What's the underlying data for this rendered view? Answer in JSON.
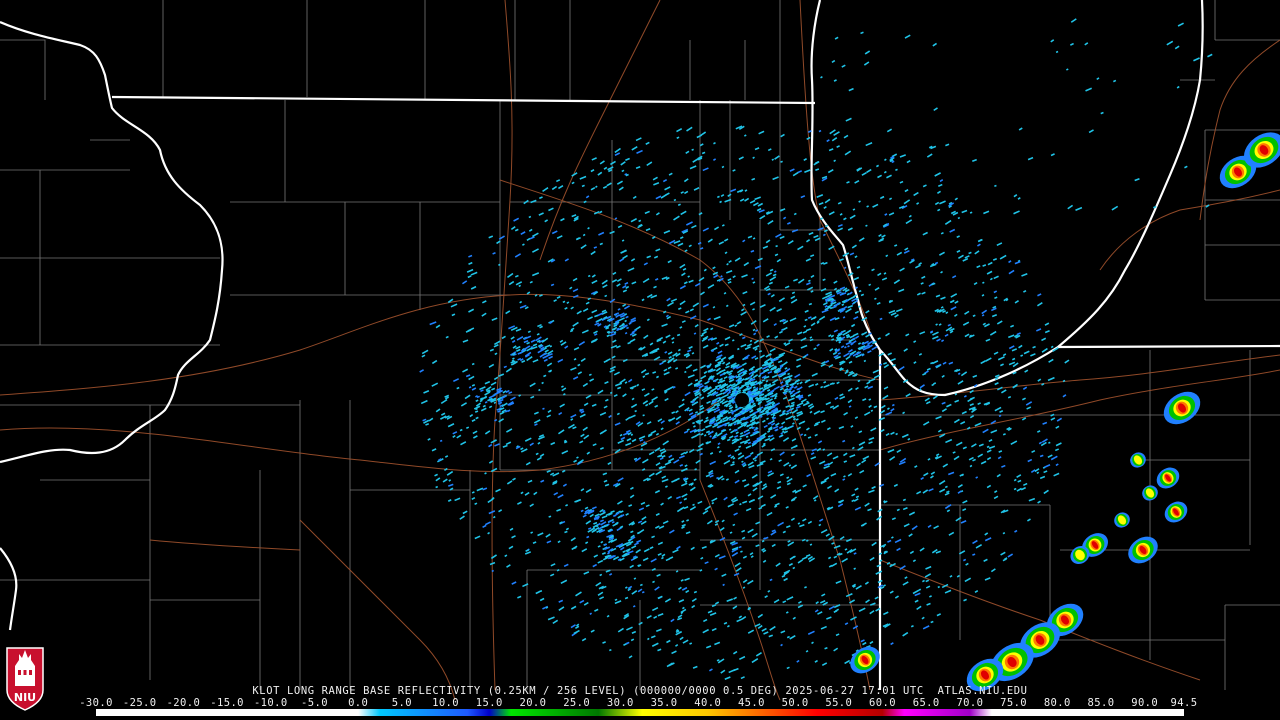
{
  "product": {
    "caption": "KLOT LONG RANGE BASE REFLECTIVITY (0.25KM / 256 LEVEL) (000000/0000 0.5 DEG) 2025-06-27 17:01 UTC  ATLAS.NIU.EDU"
  },
  "logo": {
    "text": "NIU"
  },
  "scale": {
    "ticks": [
      "-30.0",
      "-25.0",
      "-20.0",
      "-15.0",
      "-10.0",
      "-5.0",
      "0.0",
      "5.0",
      "10.0",
      "15.0",
      "20.0",
      "25.0",
      "30.0",
      "35.0",
      "40.0",
      "45.0",
      "50.0",
      "55.0",
      "60.0",
      "65.0",
      "70.0",
      "75.0",
      "80.0",
      "85.0",
      "90.0",
      "94.5"
    ],
    "stops": [
      {
        "dbz": -30,
        "color": "#ffffff"
      },
      {
        "dbz": 0,
        "color": "#ffffff"
      },
      {
        "dbz": 2.5,
        "color": "#00c8ff"
      },
      {
        "dbz": 12.5,
        "color": "#1e5aff"
      },
      {
        "dbz": 15,
        "color": "#0000c8"
      },
      {
        "dbz": 17.5,
        "color": "#00e600"
      },
      {
        "dbz": 27.5,
        "color": "#007800"
      },
      {
        "dbz": 32.5,
        "color": "#ffff00"
      },
      {
        "dbz": 40,
        "color": "#ffc800"
      },
      {
        "dbz": 45,
        "color": "#ff7800"
      },
      {
        "dbz": 52.5,
        "color": "#ff0000"
      },
      {
        "dbz": 60,
        "color": "#b40000"
      },
      {
        "dbz": 62.5,
        "color": "#ff00ff"
      },
      {
        "dbz": 70,
        "color": "#a000c8"
      },
      {
        "dbz": 72.5,
        "color": "#ffffff"
      },
      {
        "dbz": 94.5,
        "color": "#ffffff"
      }
    ]
  },
  "colors": {
    "background": "#000000",
    "state_borders": "#ffffff",
    "county_lines": "#8c8c8c",
    "roads": "#a0522d",
    "echo_light": "#20c4e8",
    "echo_moderate": "#2080ff"
  }
}
